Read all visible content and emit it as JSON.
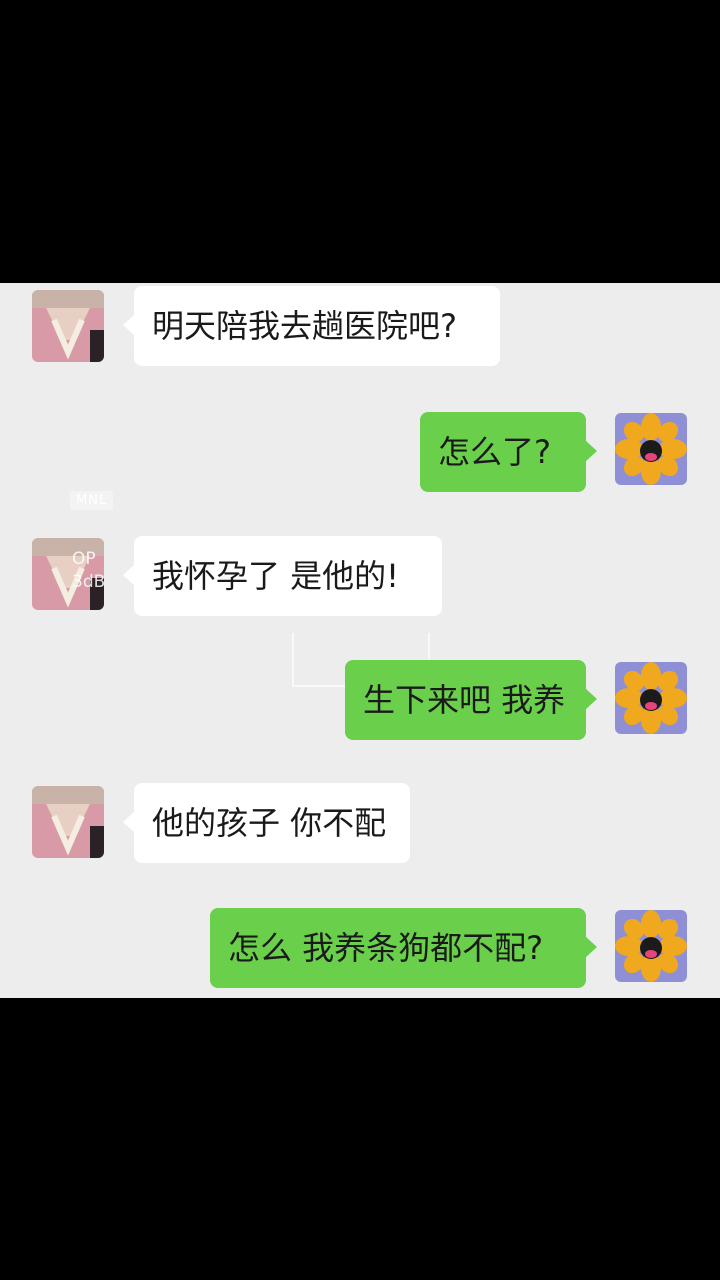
{
  "messages": [
    {
      "side": "in",
      "text": "明天陪我去趟医院吧?"
    },
    {
      "side": "out",
      "text": "怎么了?"
    },
    {
      "side": "in",
      "text": "我怀孕了 是他的!"
    },
    {
      "side": "out",
      "text": "生下来吧 我养"
    },
    {
      "side": "in",
      "text": "他的孩子 你不配"
    },
    {
      "side": "out",
      "text": "怎么 我养条狗都不配?"
    }
  ],
  "overlay": {
    "tag": "MNL",
    "line1": "OP",
    "line2": "3dB"
  },
  "colors": {
    "incoming_bubble": "#ffffff",
    "outgoing_bubble": "#6ad04c",
    "chat_background": "#ededed"
  }
}
